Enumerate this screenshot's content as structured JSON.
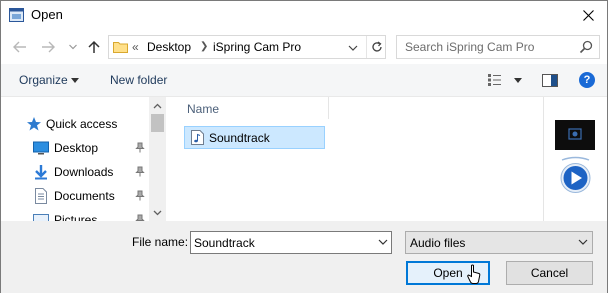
{
  "window": {
    "title": "Open"
  },
  "address": {
    "chevrons": "«",
    "crumbs": [
      "Desktop",
      "iSpring Cam Pro"
    ]
  },
  "search": {
    "placeholder": "Search iSpring Cam Pro"
  },
  "toolbar": {
    "organize": "Organize",
    "new_folder": "New folder",
    "help": "?"
  },
  "nav": {
    "items": [
      {
        "label": "Quick access",
        "icon": "star-icon"
      },
      {
        "label": "Desktop",
        "icon": "desktop-icon",
        "pinned": true
      },
      {
        "label": "Downloads",
        "icon": "download-icon",
        "pinned": true
      },
      {
        "label": "Documents",
        "icon": "documents-icon",
        "pinned": true
      },
      {
        "label": "Pictures",
        "icon": "pictures-icon",
        "pinned": true
      }
    ]
  },
  "files": {
    "column_name": "Name",
    "items": [
      {
        "label": "Soundtrack",
        "icon": "audio-file-icon",
        "selected": true
      }
    ]
  },
  "bottom": {
    "file_name_label": "File name:",
    "file_name_value": "Soundtrack",
    "file_type": "Audio files",
    "open_label": "Open",
    "cancel_label": "Cancel"
  },
  "colors": {
    "accent": "#0078d7",
    "selection": "#cce8ff",
    "link": "#1e395b"
  }
}
